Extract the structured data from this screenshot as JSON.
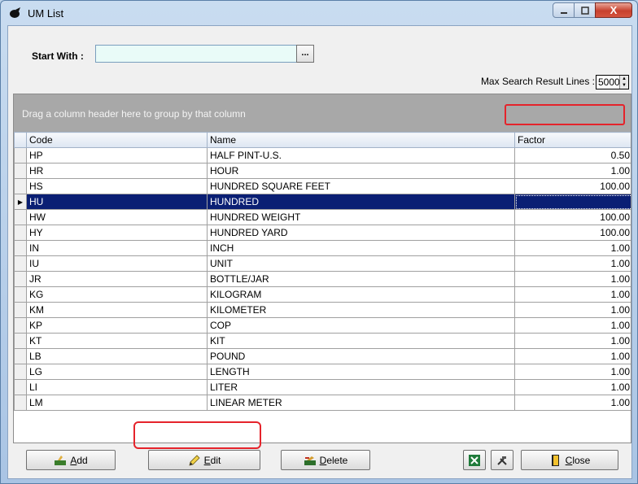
{
  "window": {
    "title": "UM List",
    "buttons": {
      "minimize": "–",
      "maximize": "□",
      "close": "X"
    }
  },
  "filter": {
    "start_with_label": "Start With :",
    "start_with_value": "",
    "browse_label": "...",
    "max_lines_label": "Max Search Result Lines :",
    "max_lines_value": "5000"
  },
  "grid": {
    "group_hint": "Drag a column header here to group by that column",
    "columns": [
      "Code",
      "Name",
      "Factor"
    ],
    "selected_row_index": 3,
    "rows": [
      {
        "code": "HP",
        "name": "HALF PINT-U.S.",
        "factor": "0.50"
      },
      {
        "code": "HR",
        "name": "HOUR",
        "factor": "1.00"
      },
      {
        "code": "HS",
        "name": "HUNDRED SQUARE FEET",
        "factor": "100.00"
      },
      {
        "code": "HU",
        "name": "HUNDRED",
        "factor": ""
      },
      {
        "code": "HW",
        "name": "HUNDRED WEIGHT",
        "factor": "100.00"
      },
      {
        "code": "HY",
        "name": "HUNDRED YARD",
        "factor": "100.00"
      },
      {
        "code": "IN",
        "name": "INCH",
        "factor": "1.00"
      },
      {
        "code": "IU",
        "name": "UNIT",
        "factor": "1.00"
      },
      {
        "code": "JR",
        "name": "BOTTLE/JAR",
        "factor": "1.00"
      },
      {
        "code": "KG",
        "name": "KILOGRAM",
        "factor": "1.00"
      },
      {
        "code": "KM",
        "name": "KILOMETER",
        "factor": "1.00"
      },
      {
        "code": "KP",
        "name": "COP",
        "factor": "1.00"
      },
      {
        "code": "KT",
        "name": "KIT",
        "factor": "1.00"
      },
      {
        "code": "LB",
        "name": "POUND",
        "factor": "1.00"
      },
      {
        "code": "LG",
        "name": "LENGTH",
        "factor": "1.00"
      },
      {
        "code": "LI",
        "name": "LITER",
        "factor": "1.00"
      },
      {
        "code": "LM",
        "name": "LINEAR METER",
        "factor": "1.00"
      }
    ]
  },
  "buttons": {
    "add": {
      "hotkey": "A",
      "rest": "dd"
    },
    "edit": {
      "hotkey": "E",
      "rest": "dit"
    },
    "delete": {
      "hotkey": "D",
      "rest": "elete"
    },
    "close": {
      "hotkey": "C",
      "rest": "lose"
    }
  },
  "colors": {
    "selection": "#0a1f74",
    "highlight": "#e5232b"
  }
}
